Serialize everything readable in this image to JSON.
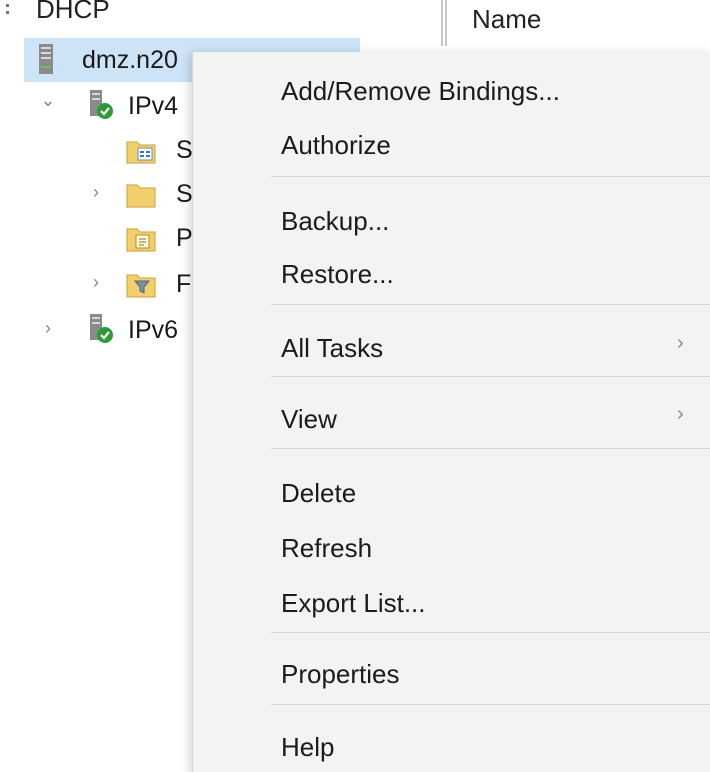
{
  "tree": {
    "root_label": "DHCP",
    "server_label": "dmz.n20",
    "ipv4_label": "IPv4",
    "child1_label": "S",
    "child2_label": "S",
    "child3_label": "P",
    "child4_label": "F",
    "ipv6_label": "IPv6"
  },
  "details": {
    "column_name": "Name"
  },
  "context_menu": {
    "add_remove_bindings": "Add/Remove Bindings...",
    "authorize": "Authorize",
    "backup": "Backup...",
    "restore": "Restore...",
    "all_tasks": "All Tasks",
    "view": "View",
    "delete": "Delete",
    "refresh": "Refresh",
    "export_list": "Export List...",
    "properties": "Properties",
    "help": "Help",
    "submenu_arrow": "›"
  },
  "icons": {
    "expanded_twisty": "⌄",
    "collapsed_twisty": "›"
  },
  "colors": {
    "selection": "#cde4f7",
    "menu_background": "#f3f3f3",
    "status_green": "#2e9b3a",
    "folder_yellow": "#f2cf6b"
  }
}
